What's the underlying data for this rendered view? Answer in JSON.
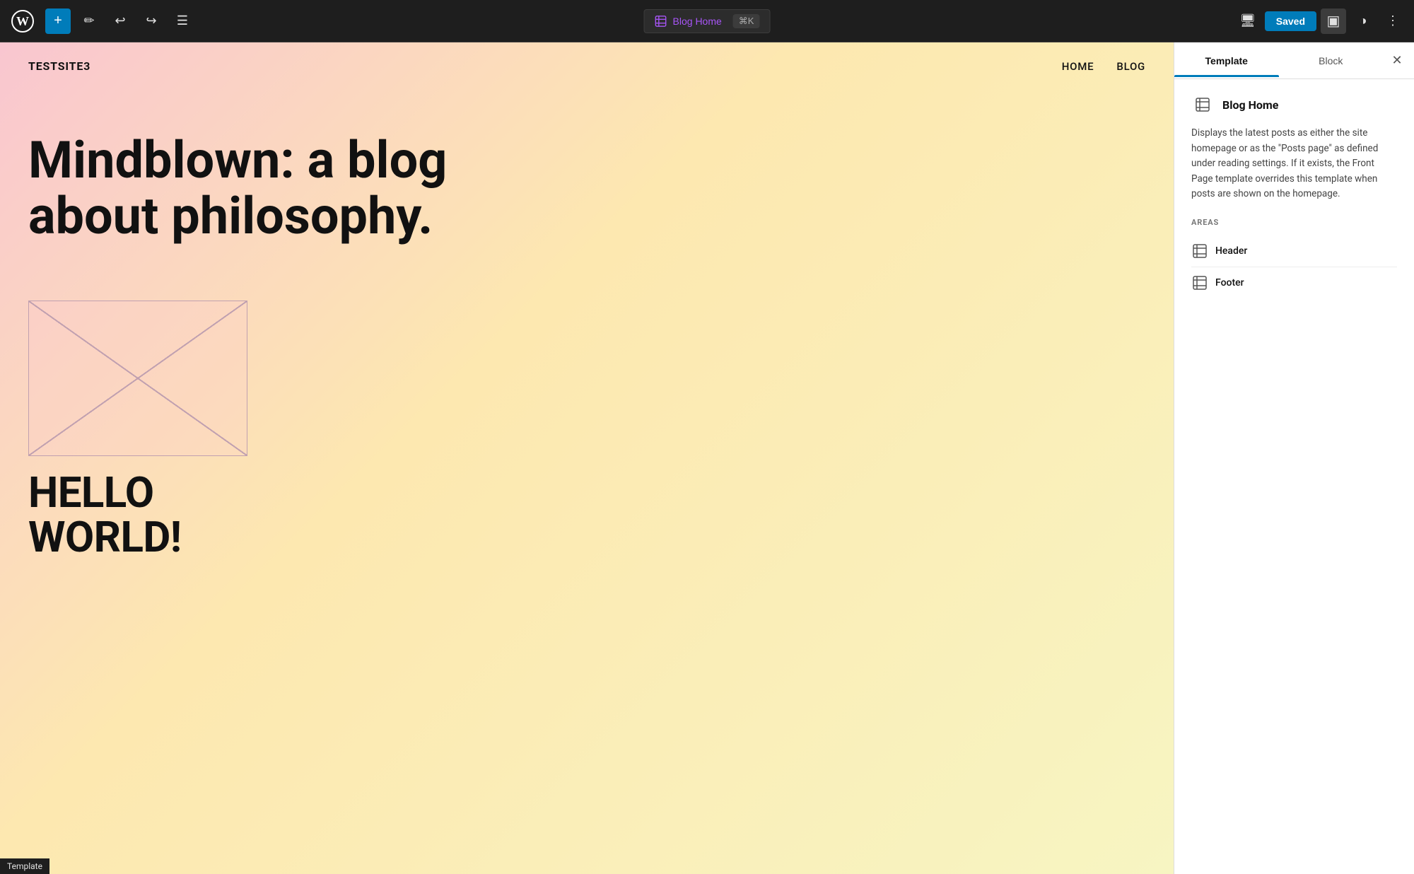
{
  "toolbar": {
    "add_label": "+",
    "saved_label": "Saved",
    "blog_home_label": "Blog Home",
    "shortcut": "⌘K"
  },
  "canvas": {
    "site_name": "TESTSITE3",
    "nav_items": [
      "HOME",
      "BLOG"
    ],
    "hero_title": "Mindblown: a blog about philosophy.",
    "post_title": "HELLO\nWORLD!",
    "bottom_label": "Template"
  },
  "panel": {
    "tab_template": "Template",
    "tab_block": "Block",
    "template_title": "Blog Home",
    "template_description": "Displays the latest posts as either the site homepage or as the \"Posts page\" as defined under reading settings. If it exists, the Front Page template overrides this template when posts are shown on the homepage.",
    "areas_label": "AREAS",
    "areas": [
      {
        "name": "Header",
        "icon": "layout-icon"
      },
      {
        "name": "Footer",
        "icon": "layout-icon"
      }
    ]
  }
}
